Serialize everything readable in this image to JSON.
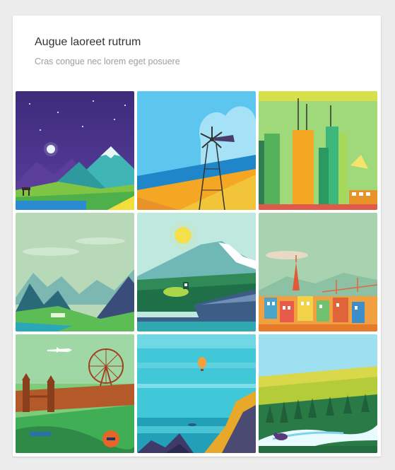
{
  "card": {
    "title": "Augue laoreet rutrum",
    "subtitle": "Cras congue nec lorem eget posuere"
  },
  "colors": {
    "background": "#ececec",
    "card": "#ffffff",
    "title": "#333333",
    "subtitle": "#9e9e9e"
  },
  "tiles": [
    {
      "id": "night-mountains"
    },
    {
      "id": "windmill-fields"
    },
    {
      "id": "city-skyscrapers"
    },
    {
      "id": "misty-mountains"
    },
    {
      "id": "sun-lake-city"
    },
    {
      "id": "san-francisco"
    },
    {
      "id": "london-landmarks"
    },
    {
      "id": "ocean-balloon"
    },
    {
      "id": "forest-river"
    }
  ]
}
